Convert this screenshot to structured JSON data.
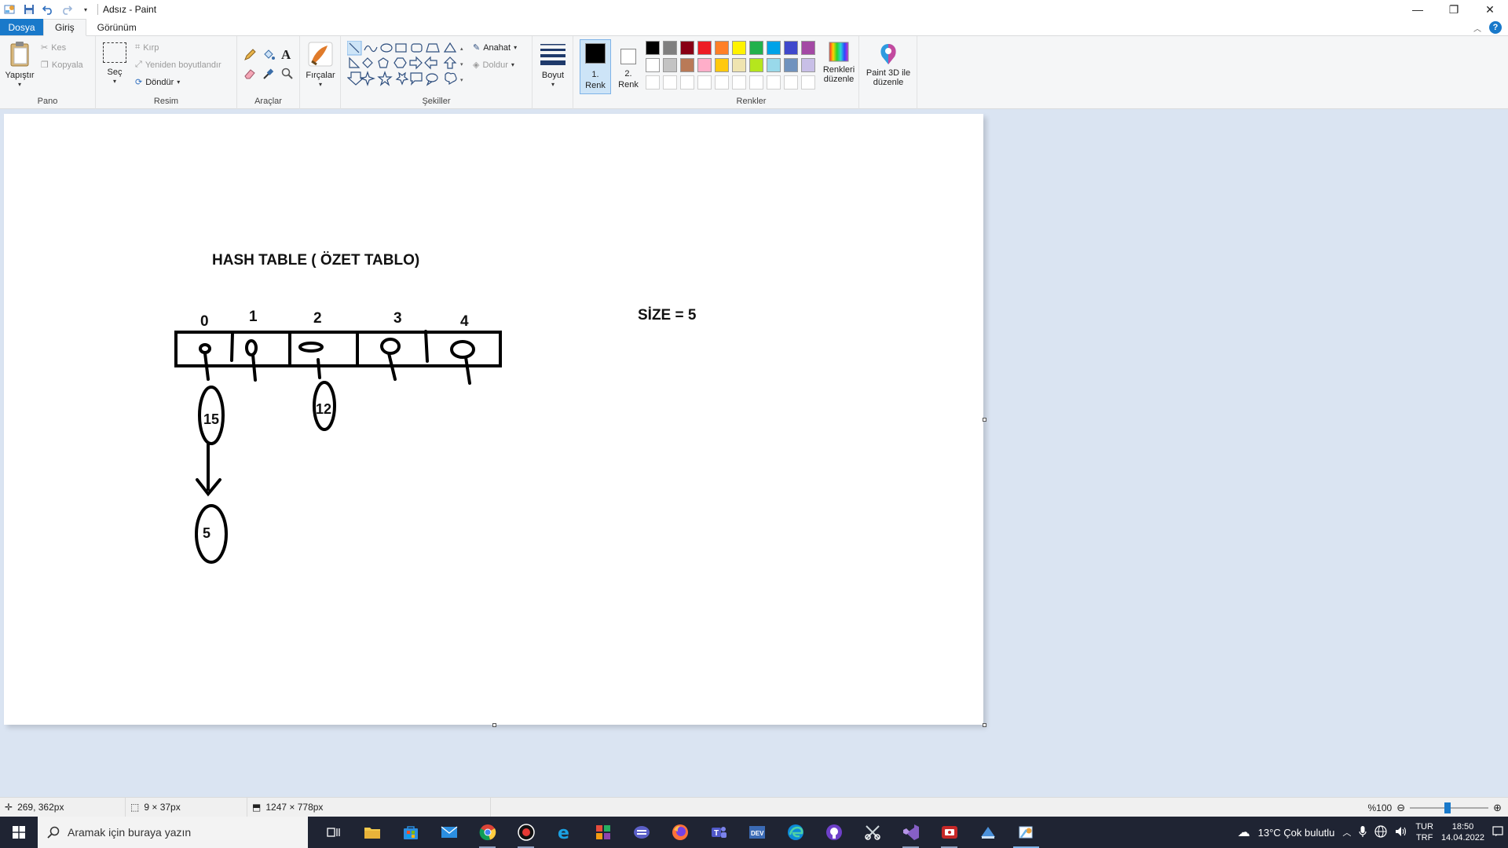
{
  "window": {
    "title": "Adsız - Paint",
    "minimize": "—",
    "maximize": "❐",
    "close": "✕"
  },
  "tabs": [
    {
      "label": "Dosya"
    },
    {
      "label": "Giriş"
    },
    {
      "label": "Görünüm"
    }
  ],
  "ribbon": {
    "pano": {
      "label": "Pano",
      "paste": "Yapıştır",
      "cut": "Kes",
      "copy": "Kopyala"
    },
    "resim": {
      "label": "Resim",
      "select": "Seç",
      "crop": "Kırp",
      "resize": "Yeniden boyutlandır",
      "rotate": "Döndür"
    },
    "araclar": {
      "label": "Araçlar",
      "brushes": "Fırçalar"
    },
    "sekiller": {
      "label": "Şekiller",
      "outline": "Anahat",
      "fill": "Doldur"
    },
    "size": "Boyut",
    "color1": {
      "line1": "1.",
      "line2": "Renk"
    },
    "color2": {
      "line1": "2.",
      "line2": "Renk"
    },
    "renkler": {
      "label": "Renkler",
      "edit_line1": "Renkleri",
      "edit_line2": "düzenle",
      "row1": [
        "#000000",
        "#7f7f7f",
        "#880015",
        "#ed1c24",
        "#ff7f27",
        "#fff200",
        "#22b14c",
        "#00a2e8",
        "#3f48cc",
        "#a349a4"
      ],
      "row2": [
        "#ffffff",
        "#c3c3c3",
        "#b97a57",
        "#ffaec9",
        "#ffc90e",
        "#efe4b0",
        "#b5e61d",
        "#99d9ea",
        "#7092be",
        "#c8bfe7"
      ]
    },
    "paint3d": {
      "line1": "Paint 3D ile",
      "line2": "düzenle"
    }
  },
  "canvas": {
    "title": "HASH TABLE ( ÖZET TABLO)",
    "size_label": "SİZE = 5",
    "indices": [
      "0",
      "1",
      "2",
      "3",
      "4"
    ],
    "nodes": {
      "n15": "15",
      "n12": "12",
      "n5": "5"
    }
  },
  "status": {
    "cursor": "269, 362px",
    "selection": "9 × 37px",
    "image_size": "1247 × 778px",
    "zoom": "%100"
  },
  "taskbar": {
    "search_placeholder": "Aramak için buraya yazın",
    "weather": "13°C  Çok bulutlu",
    "lang1": "TUR",
    "lang2": "TRF",
    "time": "18:50",
    "date": "14.04.2022"
  },
  "colors": {
    "accent": "#1979ca",
    "workspace": "#dae4f2",
    "taskbar": "#1f2433"
  }
}
